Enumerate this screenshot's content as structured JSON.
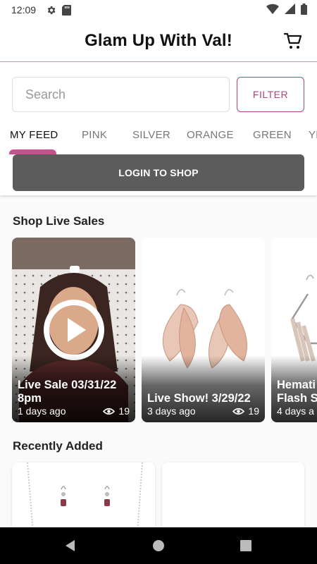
{
  "status": {
    "time": "12:09"
  },
  "header": {
    "title": "Glam Up With Val!"
  },
  "search": {
    "placeholder": "Search",
    "value": ""
  },
  "filter_label": "FILTER",
  "tabs": [
    {
      "label": "MY FEED"
    },
    {
      "label": "PINK"
    },
    {
      "label": "SILVER"
    },
    {
      "label": "ORANGE"
    },
    {
      "label": "GREEN"
    },
    {
      "label": "YE"
    }
  ],
  "login_label": "LOGIN TO SHOP",
  "sections": {
    "live": "Shop Live Sales",
    "recent": "Recently Added"
  },
  "live_cards": [
    {
      "title_line1": "Live Sale 03/31/22",
      "title_line2": "8pm",
      "ago": "1 days ago",
      "views": "19"
    },
    {
      "title_line1": "Live Show! 3/29/22",
      "title_line2": "",
      "ago": "3 days ago",
      "views": "19"
    },
    {
      "title_line1": "Hemati",
      "title_line2": "Flash S",
      "ago": "4 days a",
      "views": ""
    }
  ],
  "colors": {
    "accent": "#b0447a",
    "tab_indicator": "#c8508e",
    "login_button": "#5c5c5c"
  }
}
